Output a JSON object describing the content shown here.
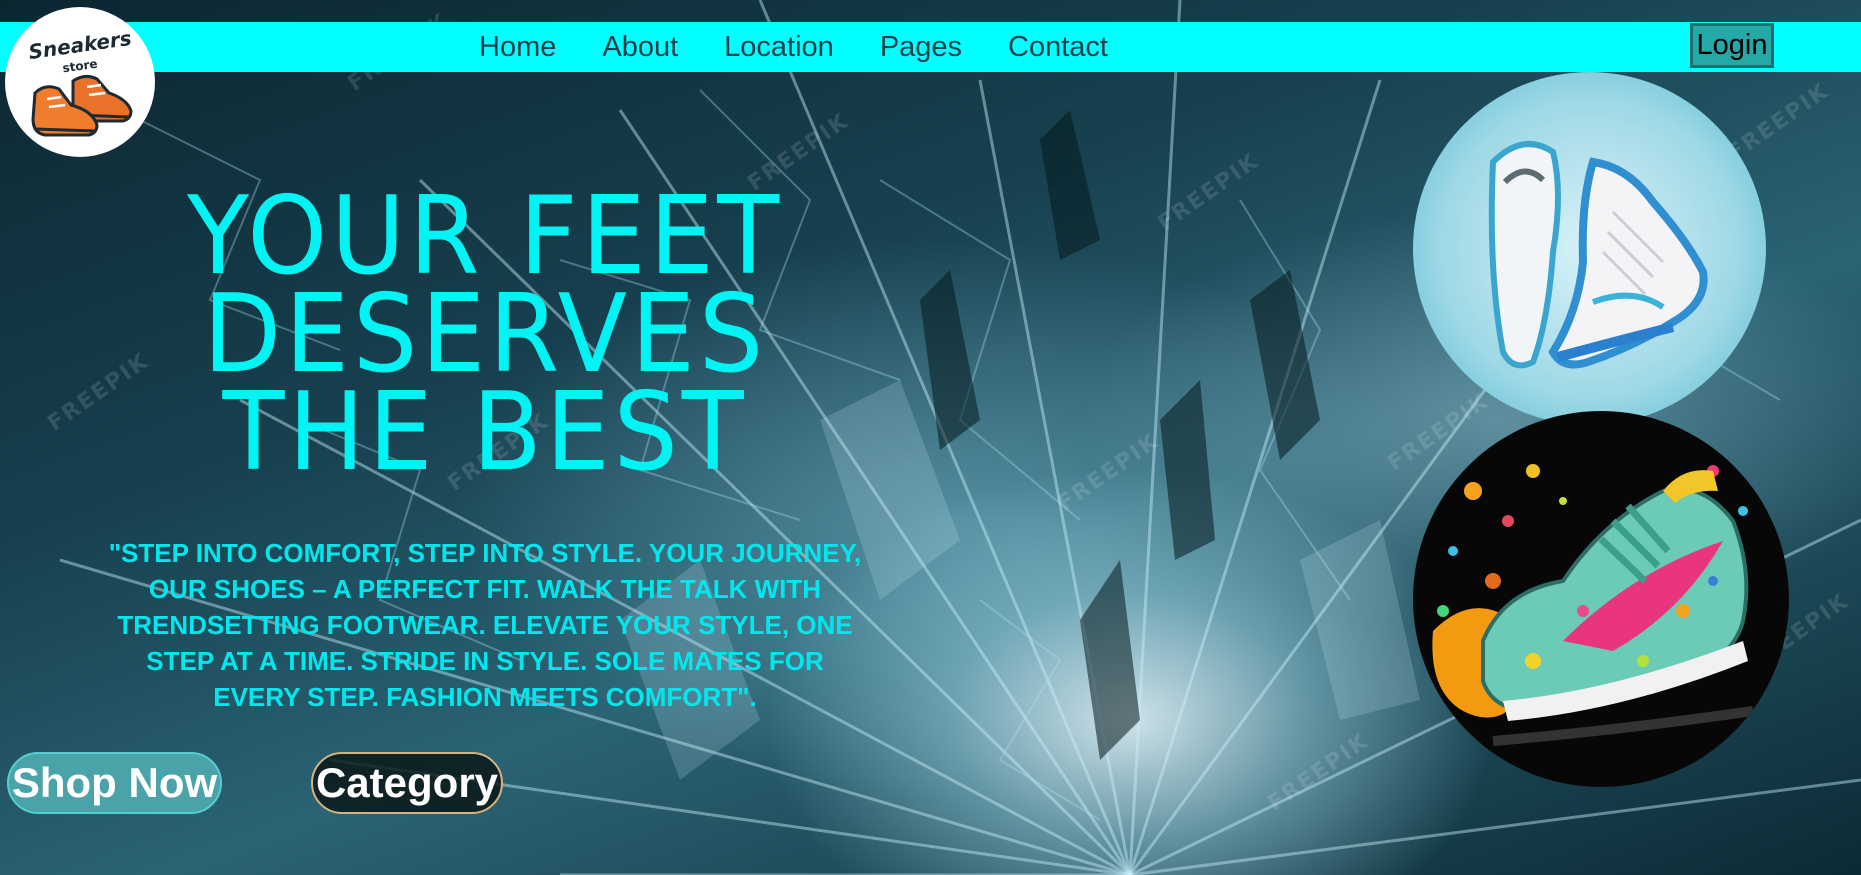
{
  "logo": {
    "title": "Sneakers",
    "subtitle": "store"
  },
  "nav": {
    "items": [
      "Home",
      "About",
      "Location",
      "Pages",
      "Contact"
    ],
    "login_label": "Login"
  },
  "hero": {
    "headline_lines": [
      "YOUR FEET",
      "DESERVES",
      "THE BEST"
    ],
    "tagline_lines": [
      "\"STEP INTO COMFORT, STEP INTO STYLE. YOUR JOURNEY,",
      "OUR SHOES – A PERFECT FIT. WALK THE TALK WITH",
      "TRENDSETTING FOOTWEAR. ELEVATE YOUR STYLE, ONE",
      "STEP AT A TIME. STRIDE IN STYLE. SOLE MATES FOR",
      "EVERY STEP. FASHION MEETS COMFORT\"."
    ],
    "shop_now_label": "Shop Now",
    "category_label": "Category"
  },
  "background": {
    "watermark_text": "FREEPIK"
  },
  "colors": {
    "accent": "#00ffff",
    "headline": "#00f4f4",
    "login_bg": "#24a8a8",
    "shop_bg": "#4aa3a8",
    "category_border": "#d6b37e"
  },
  "icons": {
    "logo": "sneaker-logo-icon",
    "product1": "white-blue-sneaker-icon",
    "product2": "colorful-splash-sneaker-icon"
  }
}
